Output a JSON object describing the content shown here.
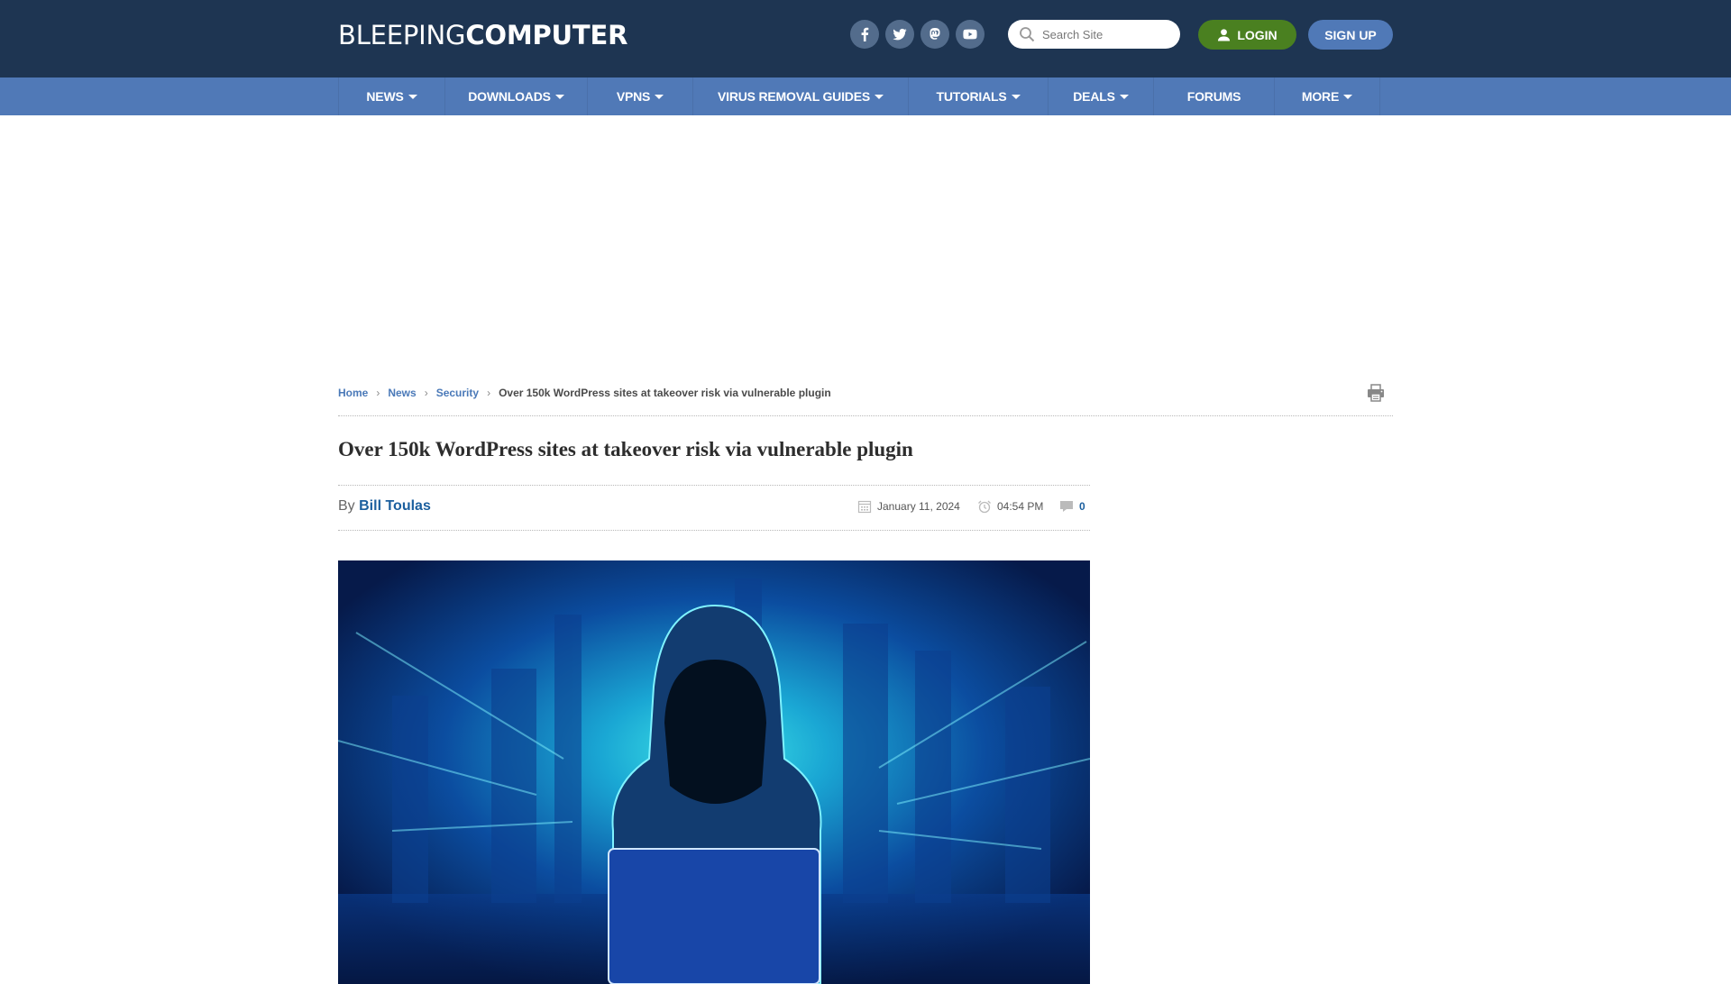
{
  "header": {
    "logo_light": "BLEEPING",
    "logo_bold": "COMPUTER",
    "social": [
      {
        "name": "facebook-icon"
      },
      {
        "name": "twitter-icon"
      },
      {
        "name": "mastodon-icon"
      },
      {
        "name": "youtube-icon"
      }
    ],
    "search_placeholder": "Search Site",
    "login_label": "LOGIN",
    "signup_label": "SIGN UP"
  },
  "nav": {
    "items": [
      {
        "label": "NEWS",
        "dropdown": true
      },
      {
        "label": "DOWNLOADS",
        "dropdown": true
      },
      {
        "label": "VPNS",
        "dropdown": true
      },
      {
        "label": "VIRUS REMOVAL GUIDES",
        "dropdown": true
      },
      {
        "label": "TUTORIALS",
        "dropdown": true
      },
      {
        "label": "DEALS",
        "dropdown": true
      },
      {
        "label": "FORUMS",
        "dropdown": false
      },
      {
        "label": "MORE",
        "dropdown": true
      }
    ]
  },
  "breadcrumb": {
    "items": [
      "Home",
      "News",
      "Security"
    ],
    "current": "Over 150k WordPress sites at takeover risk via vulnerable plugin"
  },
  "article": {
    "title": "Over 150k WordPress sites at takeover risk via vulnerable plugin",
    "by_label": "By",
    "author": "Bill Toulas",
    "date": "January 11, 2024",
    "time": "04:54 PM",
    "comment_count": "0",
    "image_alt": "Hooded hacker with laptop in front of a glowing cyan city background"
  },
  "colors": {
    "header_bg": "#1e3552",
    "nav_bg": "#5079b7",
    "login_bg": "#4a8020",
    "signup_bg": "#5079b7",
    "link": "#1b5f9e"
  }
}
